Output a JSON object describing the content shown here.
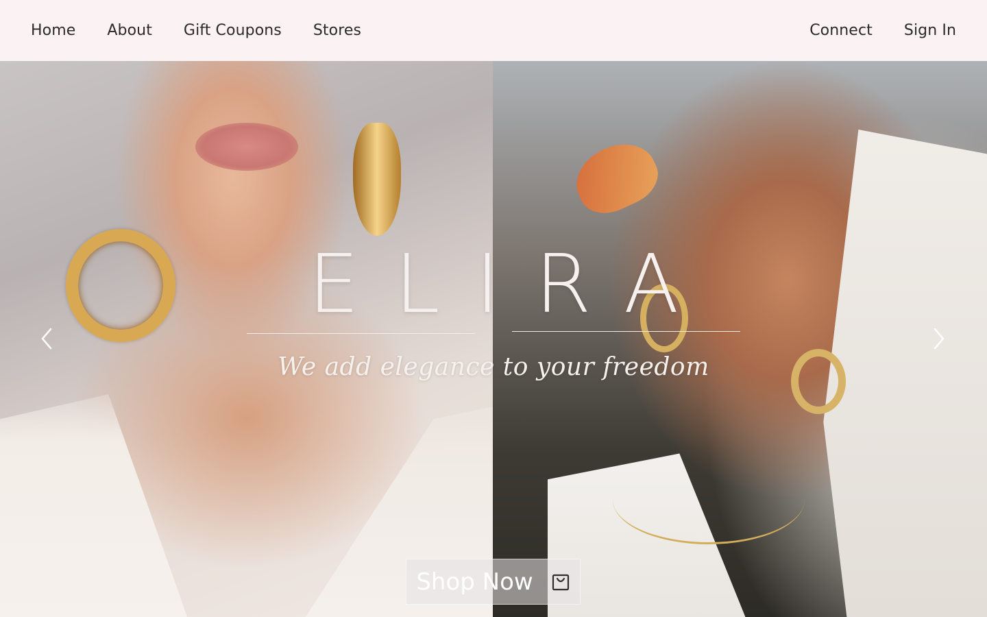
{
  "nav": {
    "left": [
      {
        "label": "Home"
      },
      {
        "label": "About"
      },
      {
        "label": "Gift Coupons"
      },
      {
        "label": "Stores"
      }
    ],
    "right": [
      {
        "label": "Connect"
      },
      {
        "label": "Sign In"
      }
    ]
  },
  "hero": {
    "brand": "ELIRA",
    "tagline": "We add elegance to your freedom",
    "cta_label": "Shop Now",
    "cta_icon": "shopping-bag-icon",
    "prev_icon": "chevron-left-icon",
    "next_icon": "chevron-right-icon"
  },
  "colors": {
    "nav_bg": "#fbf2f3",
    "nav_text": "#2a2a2a",
    "overlay_text": "#f6f1ef"
  }
}
